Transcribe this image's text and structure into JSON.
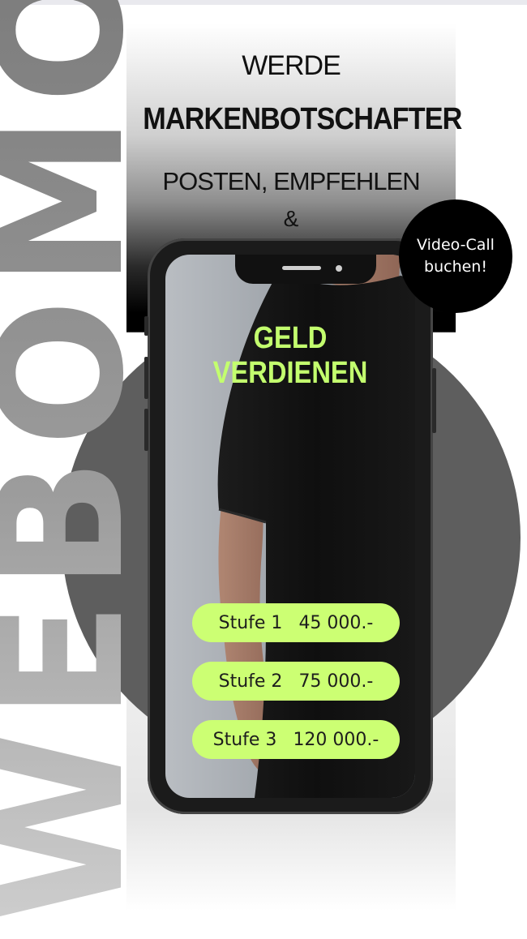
{
  "brand": {
    "vertical_word": "WEBOMO"
  },
  "headline": {
    "line1": "WERDE",
    "line2": "MARKENBOTSCHAFTER",
    "line3": "POSTEN, EMPFEHLEN",
    "line4": "&"
  },
  "phone": {
    "title": "GELD VERDIENEN",
    "tiers": [
      {
        "label": "Stufe 1",
        "value": "45 000.-"
      },
      {
        "label": "Stufe 2",
        "value": "75 000.-"
      },
      {
        "label": "Stufe 3",
        "value": "120 000.-"
      }
    ]
  },
  "cta": {
    "line1": "Video-Call",
    "line2": "buchen!"
  },
  "colors": {
    "accent": "#ccff73",
    "title_green": "#c3ff6e",
    "circle": "#5e5e5e",
    "ink": "#111111"
  }
}
